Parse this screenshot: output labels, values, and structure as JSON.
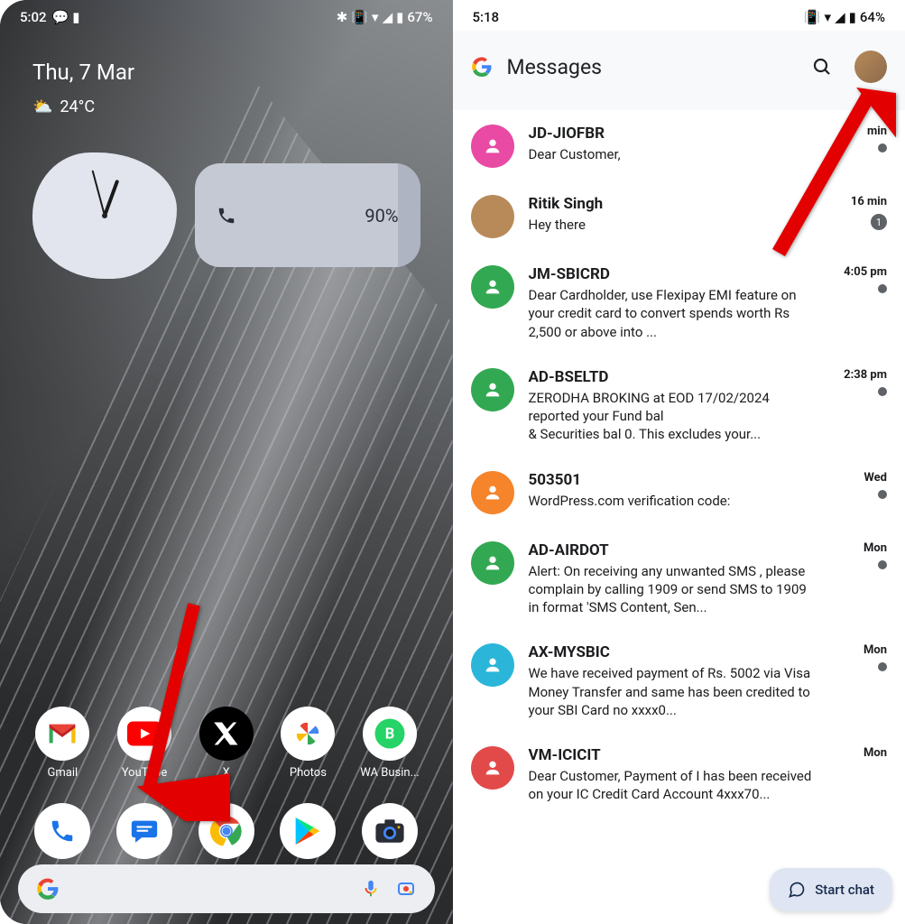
{
  "left": {
    "status": {
      "time": "5:02",
      "battery": "67%"
    },
    "date": "Thu, 7 Mar",
    "temp": "24°C",
    "battery_widget": {
      "pct": "90%"
    },
    "apps": [
      {
        "label": "Gmail",
        "icon": "gmail"
      },
      {
        "label": "YouTube",
        "icon": "youtube"
      },
      {
        "label": "X",
        "icon": "x"
      },
      {
        "label": "Photos",
        "icon": "photos"
      },
      {
        "label": "WA Busin...",
        "icon": "wab"
      }
    ],
    "dock": [
      {
        "icon": "phone"
      },
      {
        "icon": "messages"
      },
      {
        "icon": "chrome"
      },
      {
        "icon": "play"
      },
      {
        "icon": "camera"
      }
    ]
  },
  "right": {
    "status": {
      "time": "5:18",
      "battery": "64%"
    },
    "title": "Messages",
    "start_chat": "Start chat",
    "conversations": [
      {
        "sender": "JD-JIOFBR",
        "preview": "Dear Customer,",
        "time": "min",
        "avatar_color": "#e84aa4",
        "avatar_type": "person",
        "indicator": "dot"
      },
      {
        "sender": "Ritik Singh",
        "preview": "Hey there",
        "time": "16 min",
        "avatar_color": "#b88a5a",
        "avatar_type": "photo",
        "indicator": "badge",
        "badge": "1"
      },
      {
        "sender": "JM-SBICRD",
        "preview": "Dear Cardholder, use Flexipay EMI feature on your credit card to convert spends worth Rs 2,500 or above into ...",
        "time": "4:05 pm",
        "avatar_color": "#32a852",
        "avatar_type": "person",
        "indicator": "dot"
      },
      {
        "sender": "AD-BSELTD",
        "preview": "ZERODHA BROKING at EOD 17/02/2024 reported your Fund bal\n& Securities bal 0. This excludes your...",
        "time": "2:38 pm",
        "avatar_color": "#32a852",
        "avatar_type": "person",
        "indicator": "dot"
      },
      {
        "sender": "503501",
        "preview": "WordPress.com verification code:",
        "time": "Wed",
        "avatar_color": "#f5842b",
        "avatar_type": "person",
        "indicator": "dot"
      },
      {
        "sender": "AD-AIRDOT",
        "preview": "Alert: On receiving any unwanted SMS , please complain by calling 1909 or send SMS to 1909 in format 'SMS Content, Sen...",
        "time": "Mon",
        "avatar_color": "#32a852",
        "avatar_type": "person",
        "indicator": "dot"
      },
      {
        "sender": "AX-MYSBIC",
        "preview": "We have received payment of Rs. 5002 via Visa Money Transfer and same has been credited to your SBI Card no xxxx0...",
        "time": "Mon",
        "avatar_color": "#2bb6d9",
        "avatar_type": "person",
        "indicator": "dot"
      },
      {
        "sender": "VM-ICICIT",
        "preview": "Dear Customer, Payment of I has been received on your IC Credit Card Account 4xxx70...",
        "time": "Mon",
        "avatar_color": "#e24a4a",
        "avatar_type": "person",
        "indicator": ""
      }
    ]
  }
}
